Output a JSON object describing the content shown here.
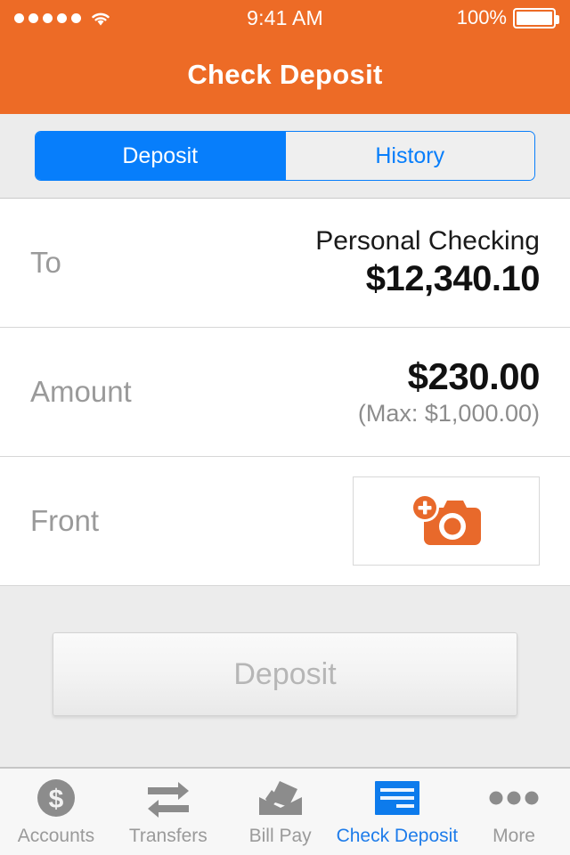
{
  "statusbar": {
    "signal_icon": "signal-dots-icon",
    "wifi_icon": "wifi-icon",
    "time": "9:41 AM",
    "battery_percent": "100%",
    "battery_icon": "battery-full-icon"
  },
  "header": {
    "title": "Check Deposit",
    "background_color": "#ED6B26"
  },
  "segmented_control": {
    "accent_color": "#077EFB",
    "selected": "Deposit",
    "options": [
      {
        "label": "Deposit",
        "active": true
      },
      {
        "label": "History",
        "active": false
      }
    ]
  },
  "form": {
    "rows": [
      {
        "label": "To",
        "account_name": "Personal Checking",
        "account_balance": "$12,340.10"
      },
      {
        "label": "Amount",
        "value": "$230.00",
        "max_hint": "(Max: $1,000.00)"
      },
      {
        "label": "Front",
        "capture_icon": "camera-add-icon",
        "capture_icon_color": "#E8692B"
      }
    ]
  },
  "actions": {
    "deposit_label": "Deposit",
    "deposit_enabled": false
  },
  "tabbar": {
    "active_color": "#1E7CEA",
    "inactive_color": "#9A9A9A",
    "items": [
      {
        "label": "Accounts",
        "icon": "dollar-circle-icon",
        "active": false
      },
      {
        "label": "Transfers",
        "icon": "transfer-arrows-icon",
        "active": false
      },
      {
        "label": "Bill Pay",
        "icon": "open-envelope-icon",
        "active": false
      },
      {
        "label": "Check Deposit",
        "icon": "check-document-icon",
        "active": true
      },
      {
        "label": "More",
        "icon": "ellipsis-icon",
        "active": false
      }
    ]
  }
}
